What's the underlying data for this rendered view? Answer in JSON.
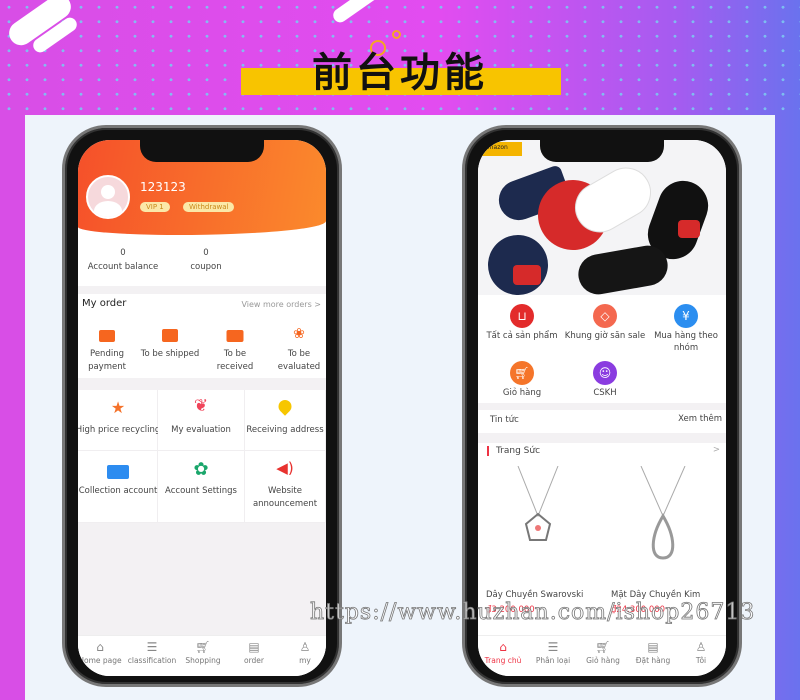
{
  "banner": {
    "title": "前台功能"
  },
  "watermark": "https://www.huzhan.com/ishop26713",
  "phone1": {
    "user": {
      "name": "123123",
      "vip": "VIP 1",
      "withdrawal": "Withdrawal"
    },
    "stats": [
      {
        "value": "0",
        "label": "Account balance"
      },
      {
        "value": "0",
        "label": "coupon"
      }
    ],
    "orders": {
      "title": "My order",
      "more": "View more orders >",
      "items": [
        {
          "label1": "Pending",
          "label2": "payment",
          "icon": "wallet-icon"
        },
        {
          "label1": "To be shipped",
          "label2": "",
          "icon": "box-icon"
        },
        {
          "label1": "To be",
          "label2": "received",
          "icon": "truck-icon"
        },
        {
          "label1": "To be",
          "label2": "evaluated",
          "icon": "flower-icon"
        }
      ]
    },
    "grid": [
      {
        "label1": "High price recycling",
        "label2": "",
        "icon": "star-icon",
        "color": "#f5722a"
      },
      {
        "label1": "My evaluation",
        "label2": "",
        "icon": "tulip-icon",
        "color": "#f0445a"
      },
      {
        "label1": "Receiving address",
        "label2": "",
        "icon": "location-pin-icon",
        "color": "#f7c600"
      },
      {
        "label1": "Collection account",
        "label2": "",
        "icon": "id-card-icon",
        "color": "#2d8cf0"
      },
      {
        "label1": "Account Settings",
        "label2": "",
        "icon": "gear-icon",
        "color": "#1aa66b"
      },
      {
        "label1": "Website",
        "label2": "announcement",
        "icon": "megaphone-icon",
        "color": "#e8322f"
      }
    ],
    "tabs": [
      {
        "label": "Home page",
        "icon": "home-icon"
      },
      {
        "label": "classification",
        "icon": "list-icon"
      },
      {
        "label": "Shopping",
        "icon": "cart-icon"
      },
      {
        "label": "order",
        "icon": "order-icon"
      },
      {
        "label": "my",
        "icon": "user-icon"
      }
    ],
    "accent": "#f7612a"
  },
  "phone2": {
    "logo": "amazon",
    "categories": [
      {
        "label1": "Tất cả sản phẩm",
        "label2": "",
        "icon": "bag-icon",
        "color": "#e32b2b"
      },
      {
        "label1": "Khung giờ săn sale",
        "label2": "",
        "icon": "tag-icon",
        "color": "#f4684f"
      },
      {
        "label1": "Mua hàng theo",
        "label2": "nhóm",
        "icon": "ticket-icon",
        "color": "#2b8ef0"
      },
      {
        "label1": "Giỏ hàng",
        "label2": "",
        "icon": "cart-icon",
        "color": "#f5752a"
      },
      {
        "label1": "CSKH",
        "label2": "",
        "icon": "support-icon",
        "color": "#8a3ce0"
      }
    ],
    "news": {
      "label": "Tin tức",
      "more": "Xem thêm"
    },
    "section": {
      "title": "Trang Sức",
      "more": ">"
    },
    "products": [
      {
        "name": "Dây Chuyền Swarovski",
        "price": "₫3.200.000"
      },
      {
        "name": "Mặt Dây Chuyền Kim",
        "price": "₫24.300.000"
      }
    ],
    "tabs": [
      {
        "label": "Trang chủ",
        "icon": "home-icon",
        "active": true
      },
      {
        "label": "Phân loại",
        "icon": "list-icon"
      },
      {
        "label": "Giỏ hàng",
        "icon": "cart-icon"
      },
      {
        "label": "Đặt hàng",
        "icon": "order-icon"
      },
      {
        "label": "Tôi",
        "icon": "user-icon"
      }
    ],
    "accent": "#ee3344"
  }
}
